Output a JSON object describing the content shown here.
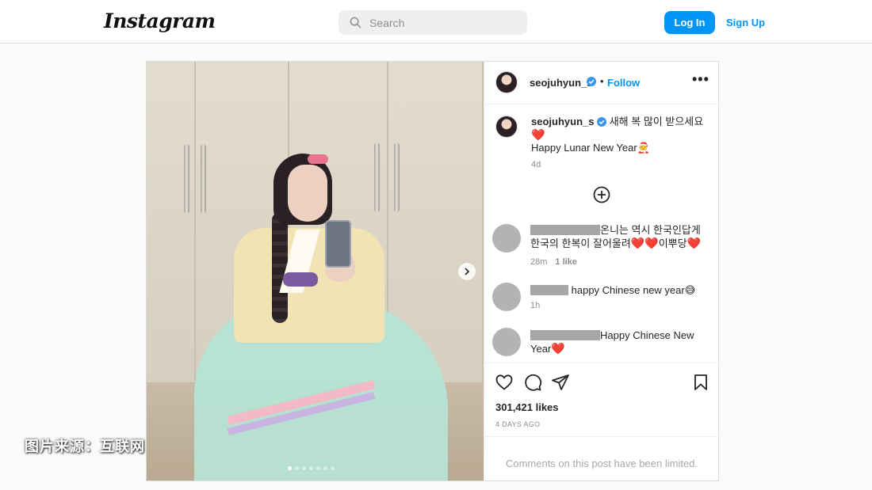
{
  "header": {
    "logo": "Instagram",
    "search_placeholder": "Search",
    "login_label": "Log In",
    "signup_label": "Sign Up"
  },
  "post": {
    "username": "seojuhyun_s",
    "bullet": "•",
    "follow_label": "Follow",
    "more_label": "•••",
    "caption_line1": "새해 복 많이 받으세요",
    "caption_heart": "❤️",
    "caption_line2": "Happy Lunar New Year🧑‍🎄",
    "caption_time": "4d",
    "slide_count": 7,
    "active_slide": 1,
    "comments": [
      {
        "text_a": "온니는 역시 한국인답게 한국의 한복이 잘어울려",
        "hearts": "❤️❤️",
        "text_b": "이뿌당",
        "heart_end": "❤️",
        "time": "28m",
        "likes": "1 like"
      },
      {
        "text": "happy Chinese new year😅",
        "time": "1h"
      },
      {
        "text": "Happy Chinese New Year",
        "heart_end": "❤️"
      }
    ],
    "likes": "301,421 likes",
    "posted": "4 DAYS AGO",
    "limited": "Comments on this post have been limited."
  },
  "watermark": "图片来源：互联网",
  "colors": {
    "accent": "#0095f6",
    "heart": "#e0142a",
    "verified": "#3897f0"
  }
}
